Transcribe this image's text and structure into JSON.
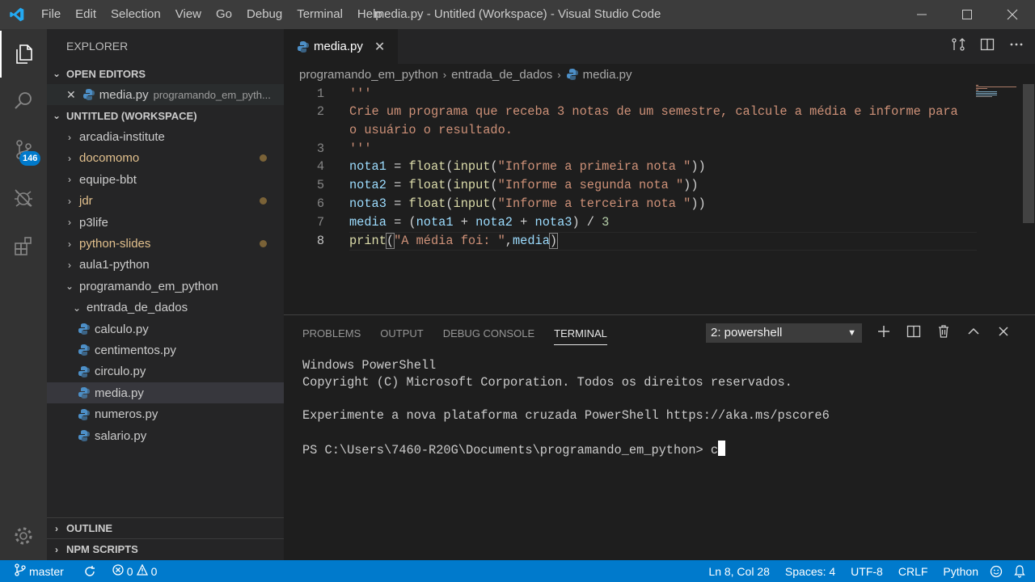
{
  "window": {
    "title": "media.py - Untitled (Workspace) - Visual Studio Code",
    "menu": [
      "File",
      "Edit",
      "Selection",
      "View",
      "Go",
      "Debug",
      "Terminal",
      "Help"
    ]
  },
  "activity": {
    "scm_badge": "146"
  },
  "sidebar": {
    "title": "EXPLORER",
    "open_editors": {
      "label": "OPEN EDITORS",
      "items": [
        {
          "name": "media.py",
          "path": "programando_em_pyth..."
        }
      ]
    },
    "workspace": {
      "label": "UNTITLED (WORKSPACE)",
      "folders": [
        {
          "name": "arcadia-institute",
          "modified": false
        },
        {
          "name": "docomomo",
          "modified": true
        },
        {
          "name": "equipe-bbt",
          "modified": false
        },
        {
          "name": "jdr",
          "modified": true
        },
        {
          "name": "p3life",
          "modified": false
        },
        {
          "name": "python-slides",
          "modified": true
        },
        {
          "name": "aula1-python",
          "modified": false
        },
        {
          "name": "programando_em_python",
          "modified": false
        }
      ],
      "subfolder": "entrada_de_dados",
      "files": [
        "calculo.py",
        "centimentos.py",
        "circulo.py",
        "media.py",
        "numeros.py",
        "salario.py"
      ],
      "selected_file": "media.py"
    },
    "outline_label": "OUTLINE",
    "npm_label": "NPM SCRIPTS"
  },
  "editor": {
    "tab_label": "media.py",
    "breadcrumb": [
      "programando_em_python",
      "entrada_de_dados",
      "media.py"
    ],
    "line_numbers": [
      "1",
      "2",
      "",
      "3",
      "4",
      "5",
      "6",
      "7",
      "8"
    ],
    "docstring": {
      "open": "'''",
      "line2a": "Crie um programa que receba 3 notas de um semestre, calcule a média e informe para",
      "line2b": "o usuário o resultado.",
      "close": "'''"
    },
    "code": {
      "l4": {
        "var": "nota1",
        "eq": " = ",
        "f1": "float",
        "p1": "(",
        "f2": "input",
        "p2": "(",
        "s": "\"Informe a primeira nota \"",
        "end": "))"
      },
      "l5": {
        "var": "nota2",
        "eq": " = ",
        "f1": "float",
        "p1": "(",
        "f2": "input",
        "p2": "(",
        "s": "\"Informe a segunda nota \"",
        "end": "))"
      },
      "l6": {
        "var": "nota3",
        "eq": " = ",
        "f1": "float",
        "p1": "(",
        "f2": "input",
        "p2": "(",
        "s": "\"Informe a terceira nota \"",
        "end": "))"
      },
      "l7": {
        "var": "media",
        "rest1": " = (",
        "a": "nota1",
        "plus1": " + ",
        "b": "nota2",
        "plus2": " + ",
        "c": "nota3",
        "rest2": ") / ",
        "n": "3"
      },
      "l8": {
        "fn": "print",
        "p": "(",
        "s": "\"A média foi: \"",
        "comma": ",",
        "v": "media",
        "end": ")"
      }
    }
  },
  "panel": {
    "tabs": [
      "PROBLEMS",
      "OUTPUT",
      "DEBUG CONSOLE",
      "TERMINAL"
    ],
    "active_tab": "TERMINAL",
    "terminal_select": "2: powershell",
    "terminal_lines": [
      "Windows PowerShell",
      "Copyright (C) Microsoft Corporation. Todos os direitos reservados.",
      "",
      "Experimente a nova plataforma cruzada PowerShell https://aka.ms/pscore6",
      ""
    ],
    "prompt": "PS C:\\Users\\7460-R20G\\Documents\\programando_em_python> ",
    "typed": "c"
  },
  "statusbar": {
    "branch": "master",
    "errors": "0",
    "warnings": "0",
    "position": "Ln 8, Col 28",
    "spaces": "Spaces: 4",
    "encoding": "UTF-8",
    "eol": "CRLF",
    "language": "Python"
  },
  "colors": {
    "accent": "#007acc",
    "string": "#ce9178",
    "function": "#dcdcaa",
    "variable": "#9cdcfe"
  }
}
